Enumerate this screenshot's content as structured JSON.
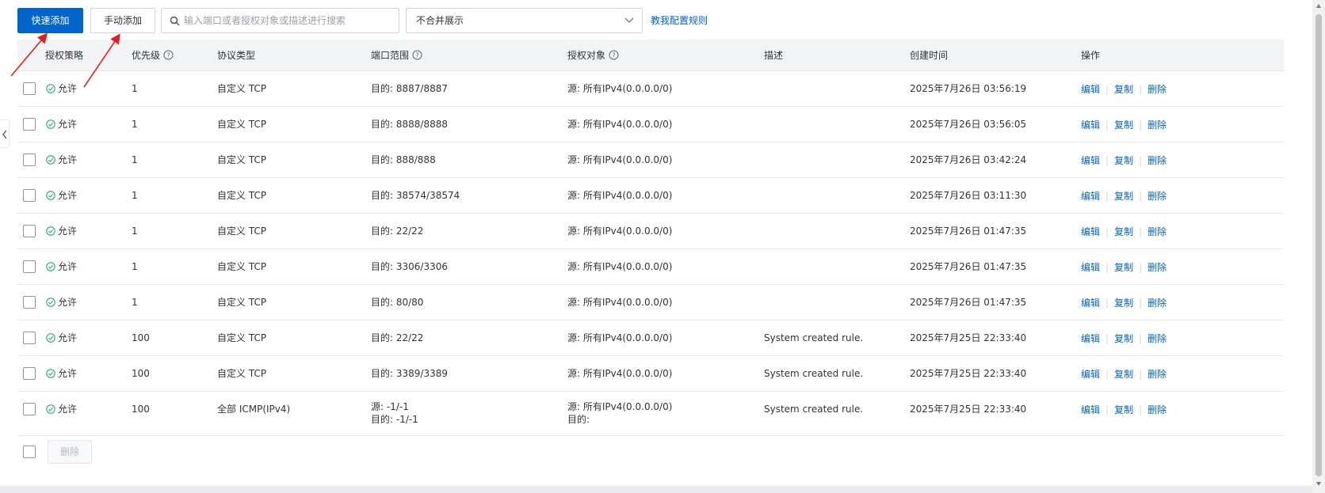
{
  "toolbar": {
    "quick_add_label": "快速添加",
    "manual_add_label": "手动添加",
    "search_placeholder": "输入端口或者授权对象或描述进行搜索",
    "search_value": "",
    "display_mode": "不合并展示",
    "help_link": "教我配置规则"
  },
  "columns": {
    "policy": "授权策略",
    "priority": "优先级",
    "protocol": "协议类型",
    "port_range": "端口范围",
    "auth_object": "授权对象",
    "description": "描述",
    "created_time": "创建时间",
    "actions": "操作"
  },
  "actions": {
    "edit": "编辑",
    "copy": "复制",
    "delete": "删除"
  },
  "rows": [
    {
      "policy": "允许",
      "priority": "1",
      "protocol": "自定义 TCP",
      "port": "目的: 8887/8887",
      "port2": "",
      "object": "源: 所有IPv4(0.0.0.0/0)",
      "object2": "",
      "desc": "",
      "created": "2025年7月26日 03:56:19"
    },
    {
      "policy": "允许",
      "priority": "1",
      "protocol": "自定义 TCP",
      "port": "目的: 8888/8888",
      "port2": "",
      "object": "源: 所有IPv4(0.0.0.0/0)",
      "object2": "",
      "desc": "",
      "created": "2025年7月26日 03:56:05"
    },
    {
      "policy": "允许",
      "priority": "1",
      "protocol": "自定义 TCP",
      "port": "目的: 888/888",
      "port2": "",
      "object": "源: 所有IPv4(0.0.0.0/0)",
      "object2": "",
      "desc": "",
      "created": "2025年7月26日 03:42:24"
    },
    {
      "policy": "允许",
      "priority": "1",
      "protocol": "自定义 TCP",
      "port": "目的: 38574/38574",
      "port2": "",
      "object": "源: 所有IPv4(0.0.0.0/0)",
      "object2": "",
      "desc": "",
      "created": "2025年7月26日 03:11:30"
    },
    {
      "policy": "允许",
      "priority": "1",
      "protocol": "自定义 TCP",
      "port": "目的: 22/22",
      "port2": "",
      "object": "源: 所有IPv4(0.0.0.0/0)",
      "object2": "",
      "desc": "",
      "created": "2025年7月26日 01:47:35"
    },
    {
      "policy": "允许",
      "priority": "1",
      "protocol": "自定义 TCP",
      "port": "目的: 3306/3306",
      "port2": "",
      "object": "源: 所有IPv4(0.0.0.0/0)",
      "object2": "",
      "desc": "",
      "created": "2025年7月26日 01:47:35"
    },
    {
      "policy": "允许",
      "priority": "1",
      "protocol": "自定义 TCP",
      "port": "目的: 80/80",
      "port2": "",
      "object": "源: 所有IPv4(0.0.0.0/0)",
      "object2": "",
      "desc": "",
      "created": "2025年7月26日 01:47:35"
    },
    {
      "policy": "允许",
      "priority": "100",
      "protocol": "自定义 TCP",
      "port": "目的: 22/22",
      "port2": "",
      "object": "源: 所有IPv4(0.0.0.0/0)",
      "object2": "",
      "desc": "System created rule.",
      "created": "2025年7月25日 22:33:40"
    },
    {
      "policy": "允许",
      "priority": "100",
      "protocol": "自定义 TCP",
      "port": "目的: 3389/3389",
      "port2": "",
      "object": "源: 所有IPv4(0.0.0.0/0)",
      "object2": "",
      "desc": "System created rule.",
      "created": "2025年7月25日 22:33:40"
    },
    {
      "policy": "允许",
      "priority": "100",
      "protocol": "全部 ICMP(IPv4)",
      "port": "源: -1/-1",
      "port2": "目的: -1/-1",
      "object": "源: 所有IPv4(0.0.0.0/0)",
      "object2": "目的:",
      "desc": "System created rule.",
      "created": "2025年7月25日 22:33:40"
    }
  ],
  "footer": {
    "delete_label": "删除"
  },
  "colors": {
    "primary": "#0064c8",
    "success": "#23b066",
    "annotation": "#e02020"
  }
}
